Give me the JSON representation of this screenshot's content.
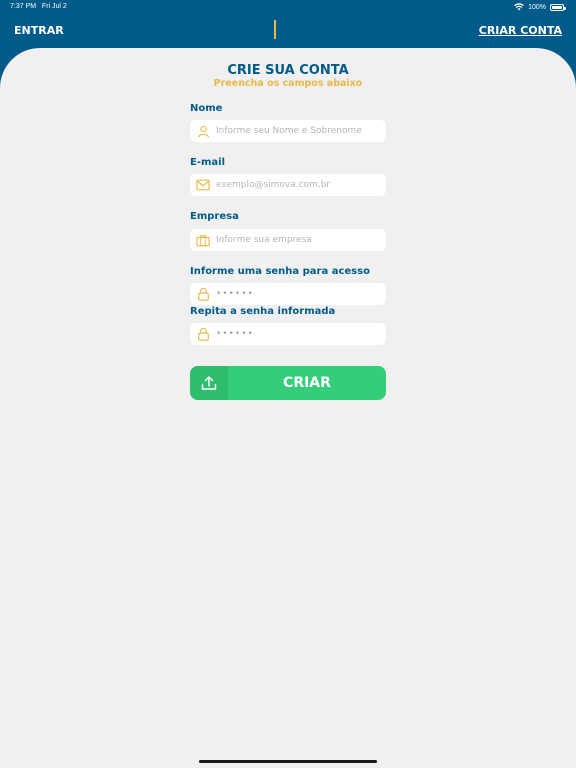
{
  "status_bar": {
    "time": "7:37 PM",
    "date": "Fri Jul 2",
    "battery": "100%"
  },
  "nav": {
    "entrar": "ENTRAR",
    "criar_conta": "CRIAR CONTA"
  },
  "header": {
    "title": "CRIE SUA CONTA",
    "subtitle": "Preencha os campos abaixo"
  },
  "form": {
    "nome": {
      "label": "Nome",
      "placeholder": "Informe seu Nome e Sobrenome",
      "icon": "user-icon"
    },
    "email": {
      "label": "E-mail",
      "placeholder": "exemplo@simova.com.br",
      "icon": "mail-icon"
    },
    "empresa": {
      "label": "Empresa",
      "placeholder": "Informe sua empresa",
      "icon": "briefcase-icon"
    },
    "senha": {
      "label": "Informe uma senha para acesso",
      "value": "••••••",
      "icon": "lock-icon"
    },
    "repita_senha": {
      "label": "Repita a senha informada",
      "value": "••••••",
      "icon": "lock-icon"
    }
  },
  "submit": {
    "label": "CRIAR",
    "icon": "upload-icon"
  },
  "colors": {
    "primary": "#005a8a",
    "accent": "#e9b949",
    "success": "#35cc7a",
    "background": "#f0f0f0"
  }
}
